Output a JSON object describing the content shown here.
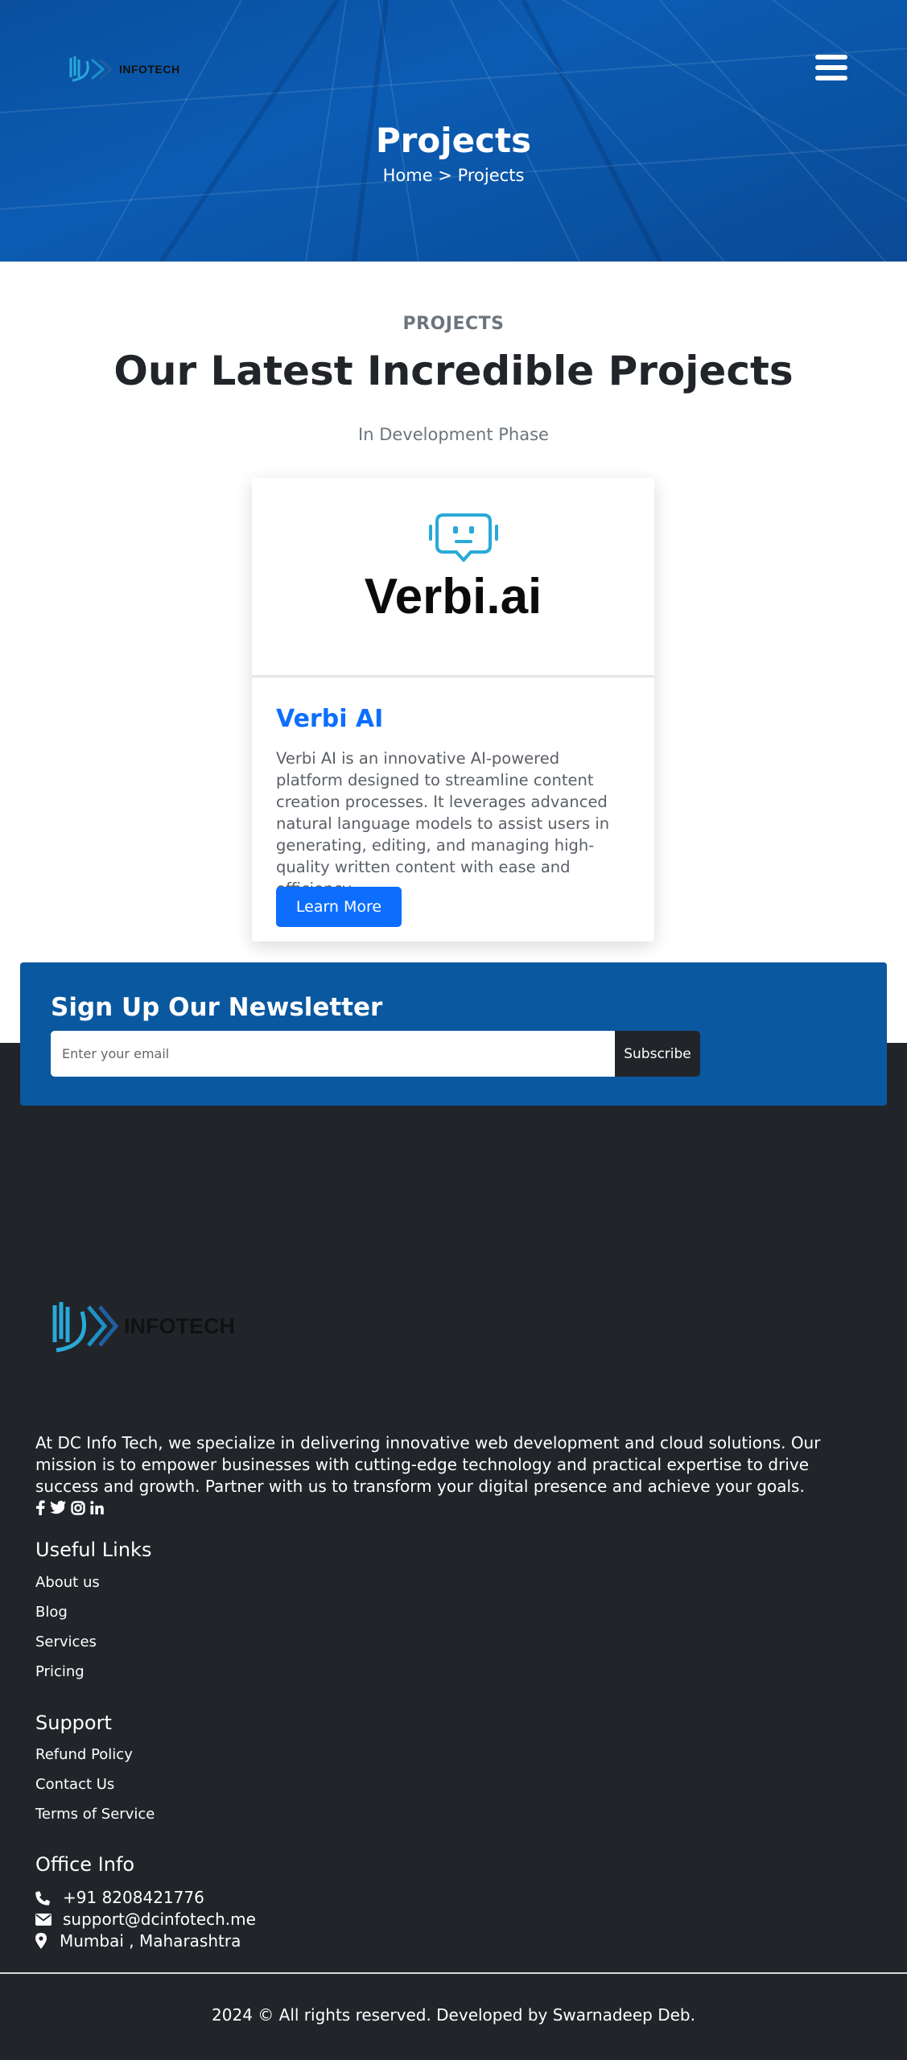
{
  "header": {
    "logo_text": "INFOTECH",
    "title": "Projects",
    "breadcrumb": {
      "home": "Home",
      "separator": ">",
      "current": "Projects"
    }
  },
  "projects": {
    "eyebrow": "PROJECTS",
    "title": "Our Latest Incredible Projects",
    "subtitle": "In Development Phase",
    "cards": [
      {
        "logo_text": "Verbi.ai",
        "title": "Verbi AI",
        "description": "Verbi AI is an innovative AI-powered platform designed to streamline content creation processes. It leverages advanced natural language models to assist users in generating, editing, and managing high-quality written content with ease and efficiency.",
        "button_label": "Learn More"
      }
    ]
  },
  "newsletter": {
    "title": "Sign Up Our Newsletter",
    "placeholder": "Enter your email",
    "button_label": "Subscribe"
  },
  "footer": {
    "logo_text": "INFOTECH",
    "about": "At DC Info Tech, we specialize in delivering innovative web development and cloud solutions. Our mission is to empower businesses with cutting-edge technology and practical expertise to drive success and growth. Partner with us to transform your digital presence and achieve your goals.",
    "social_icons": [
      "facebook-icon",
      "twitter-icon",
      "instagram-icon",
      "linkedin-icon"
    ],
    "useful_links": {
      "heading": "Useful Links",
      "items": [
        "About us",
        "Blog",
        "Services",
        "Pricing"
      ]
    },
    "support": {
      "heading": "Support",
      "items": [
        "Refund Policy",
        "Contact Us",
        "Terms of Service"
      ]
    },
    "office": {
      "heading": "Office Info",
      "phone": "+91 8208421776",
      "email": "support@dcinfotech.me",
      "location": "Mumbai , Maharashtra"
    },
    "copyright": "2024 © All rights reserved. Developed by Swarnadeep Deb."
  },
  "colors": {
    "hero_blue": "#0b5cb3",
    "accent": "#0d6efd",
    "newsletter_bg": "#0a589f",
    "footer_bg": "#212429"
  }
}
